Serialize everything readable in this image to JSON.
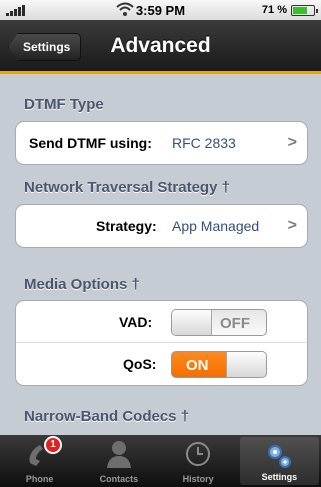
{
  "status_bar": {
    "time": "3:59 PM",
    "battery_percent": "71 %",
    "battery_level": 0.71,
    "icons": [
      "signal-icon",
      "wifi-icon",
      "battery-icon"
    ]
  },
  "nav": {
    "back_label": "Settings",
    "title": "Advanced"
  },
  "sections": {
    "dtmf": {
      "header": "DTMF Type",
      "row_label": "Send DTMF using:",
      "row_value": "RFC 2833"
    },
    "network": {
      "header": "Network Traversal Strategy †",
      "row_label": "Strategy:",
      "row_value": "App Managed"
    },
    "media": {
      "header": "Media Options †",
      "vad_label": "VAD:",
      "vad_state": "OFF",
      "qos_label": "QoS:",
      "qos_state": "ON"
    },
    "codecs": {
      "header": "Narrow-Band Codecs †"
    }
  },
  "tabs": [
    {
      "label": "Phone",
      "icon": "phone-icon",
      "badge": "1"
    },
    {
      "label": "Contacts",
      "icon": "contacts-icon"
    },
    {
      "label": "History",
      "icon": "clock-icon"
    },
    {
      "label": "Settings",
      "icon": "gears-icon",
      "active": true
    }
  ],
  "colors": {
    "accent_orange": "#f46e00",
    "nav_border": "#e9a40e",
    "value_blue": "#324f85",
    "background": "#c5ccd4"
  }
}
